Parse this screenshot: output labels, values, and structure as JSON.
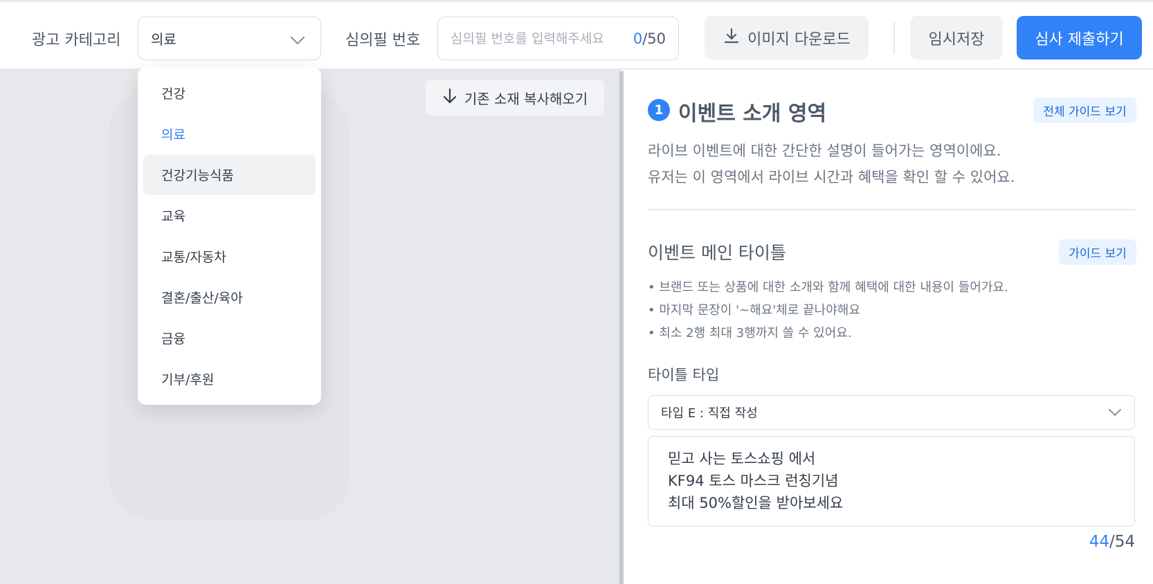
{
  "header": {
    "category_label": "광고 카테고리",
    "category_value": "의료",
    "review_label": "심의필 번호",
    "review_placeholder": "심의필 번호를 입력해주세요",
    "review_count_current": "0",
    "review_count_max": "/50",
    "download_label": "이미지 다운로드",
    "temp_save_label": "임시저장",
    "submit_label": "심사 제출하기"
  },
  "canvas": {
    "copy_label": "기존 소재 복사해오기"
  },
  "dropdown": {
    "items": [
      {
        "label": "건강"
      },
      {
        "label": "의료"
      },
      {
        "label": "건강기능식품"
      },
      {
        "label": "교육"
      },
      {
        "label": "교통/자동차"
      },
      {
        "label": "결혼/출산/육아"
      },
      {
        "label": "금융"
      },
      {
        "label": "기부/후원"
      }
    ],
    "selected": "의료",
    "hovered": "건강기능식품"
  },
  "panel": {
    "section_number": "1",
    "section_title": "이벤트 소개 영역",
    "full_guide_label": "전체 가이드 보기",
    "description_lines": [
      "라이브 이벤트에 대한 간단한 설명이 들어가는 영역이에요.",
      "유저는 이 영역에서 라이브 시간과 혜택을 확인 할 수 있어요."
    ],
    "main_title_label": "이벤트 메인 타이틀",
    "guide_label": "가이드 보기",
    "bullets": [
      "브랜드 또는 상품에 대한 소개와 함께 혜택에 대한 내용이 들어가요.",
      "마지막 문장이 '~해요'체로 끝나야해요",
      "최소 2행 최대 3행까지 쓸 수 있어요."
    ],
    "title_type_label": "타이틀 타입",
    "title_type_value": "타입 E : 직접 작성",
    "title_text": "믿고 사는 토스쇼핑 에서\nKF94 토스 마스크 런칭기념\n최대 50%할인을 받아보세요",
    "text_count_current": "44",
    "text_count_max": "/54"
  },
  "colors": {
    "accent": "#3182f6",
    "chip_bg": "#e8f3ff",
    "canvas_bg": "#e6e8eb"
  }
}
